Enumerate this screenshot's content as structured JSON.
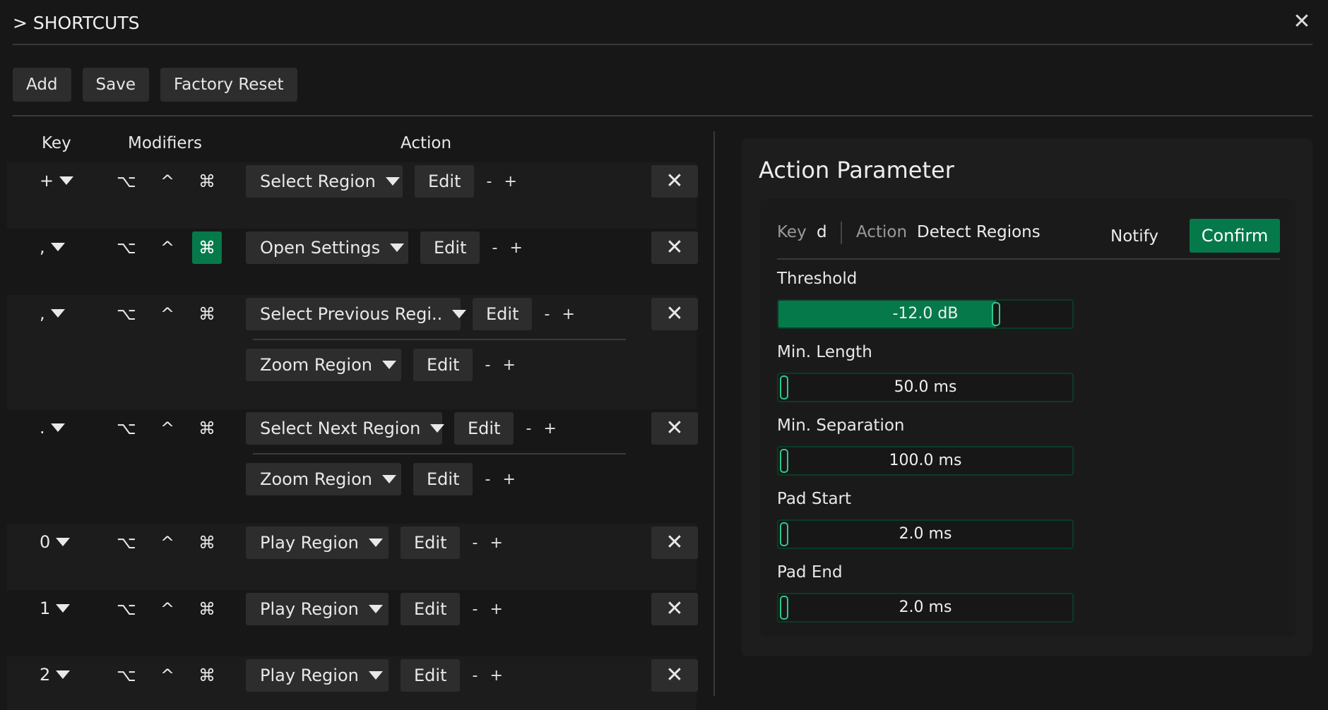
{
  "window": {
    "title": "> SHORTCUTS",
    "close_label": "✕"
  },
  "toolbar": {
    "add_label": "Add",
    "save_label": "Save",
    "factory_reset_label": "Factory Reset"
  },
  "table": {
    "headers": {
      "key": "Key",
      "modifiers": "Modifiers",
      "action": "Action"
    },
    "modifier_symbols": {
      "alt": "⌥",
      "ctrl": "^",
      "cmd": "⌘"
    },
    "edit_label": "Edit",
    "minus_label": "-",
    "plus_label": "+",
    "delete_label": "✕",
    "rows": [
      {
        "key": "+",
        "cmd_active": false,
        "actions": [
          "Select Region"
        ]
      },
      {
        "key": ",",
        "cmd_active": true,
        "actions": [
          "Open Settings"
        ]
      },
      {
        "key": ",",
        "cmd_active": false,
        "actions": [
          "Select Previous Regi..",
          "Zoom Region"
        ]
      },
      {
        "key": ".",
        "cmd_active": false,
        "actions": [
          "Select Next Region",
          "Zoom Region"
        ]
      },
      {
        "key": "0",
        "cmd_active": false,
        "actions": [
          "Play Region"
        ]
      },
      {
        "key": "1",
        "cmd_active": false,
        "actions": [
          "Play Region"
        ]
      },
      {
        "key": "2",
        "cmd_active": false,
        "actions": [
          "Play Region"
        ]
      }
    ]
  },
  "panel": {
    "title": "Action Parameter",
    "key_label": "Key",
    "key_value": "d",
    "action_label": "Action",
    "action_value": "Detect Regions",
    "notify_label": "Notify",
    "confirm_label": "Confirm",
    "params": [
      {
        "label": "Threshold",
        "value_text": "-12.0 dB",
        "fill_fraction": 0.74
      },
      {
        "label": "Min. Length",
        "value_text": "50.0 ms",
        "fill_fraction": 0.0
      },
      {
        "label": "Min. Separation",
        "value_text": "100.0 ms",
        "fill_fraction": 0.0
      },
      {
        "label": "Pad Start",
        "value_text": "2.0 ms",
        "fill_fraction": 0.0
      },
      {
        "label": "Pad End",
        "value_text": "2.0 ms",
        "fill_fraction": 0.0
      }
    ],
    "accent_color": "#06794a"
  }
}
